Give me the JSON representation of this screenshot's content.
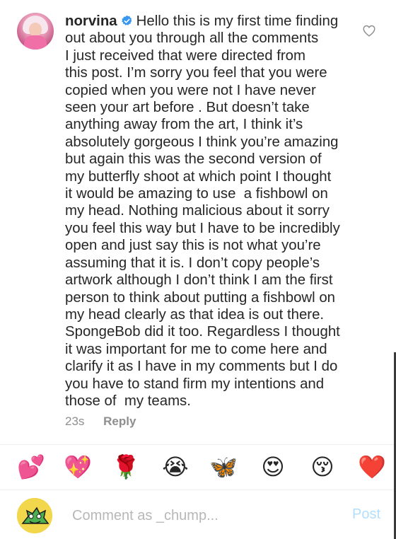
{
  "comment": {
    "username": "norvina",
    "body": "Hello this is my first time finding\nout about you through all the comments\nI just received that were directed from\nthis post. I’m sorry you feel that you were\ncopied when you were not I have never\nseen your art before . But doesn’t take\nanything away from the art, I think it’s\nabsolutely gorgeous I think you’re amazing\nbut again this was the second version of\nmy butterfly shoot at which point I thought\nit would be amazing to use  a fishbowl on\nmy head. Nothing malicious about it sorry\nyou feel this way but I have to be incredibly\nopen and just say this is not what you’re\nassuming that it is. I don’t copy people’s\nartwork although I don’t think I am the first\nperson to think about putting a fishbowl on\nmy head clearly as that idea is out there.\nSpongeBob did it too. Regardless I thought\nit was important for me to come here and\nclarify it as I have in my comments but I do\nyou have to stand firm my intentions and\nthose of  my teams.",
    "time": "23s",
    "reply_label": "Reply",
    "verified_icon": "verified-badge-icon",
    "like_icon": "heart-outline-icon",
    "verified_color": "#3897f0"
  },
  "emoji_bar": [
    {
      "name": "two-hearts-emoji",
      "glyph": "💕"
    },
    {
      "name": "sparkling-heart-emoji",
      "glyph": "💖"
    },
    {
      "name": "rose-emoji",
      "glyph": "🌹"
    },
    {
      "name": "crying-face-emoji",
      "glyph": "😭"
    },
    {
      "name": "butterfly-emoji",
      "glyph": "🦋"
    },
    {
      "name": "heart-eyes-emoji",
      "glyph": "😍"
    },
    {
      "name": "kissing-face-emoji",
      "glyph": "😚"
    },
    {
      "name": "red-heart-emoji",
      "glyph": "❤️"
    }
  ],
  "composer": {
    "placeholder": "Comment as _chump...",
    "post_label": "Post",
    "post_color": "#b2dffc"
  }
}
